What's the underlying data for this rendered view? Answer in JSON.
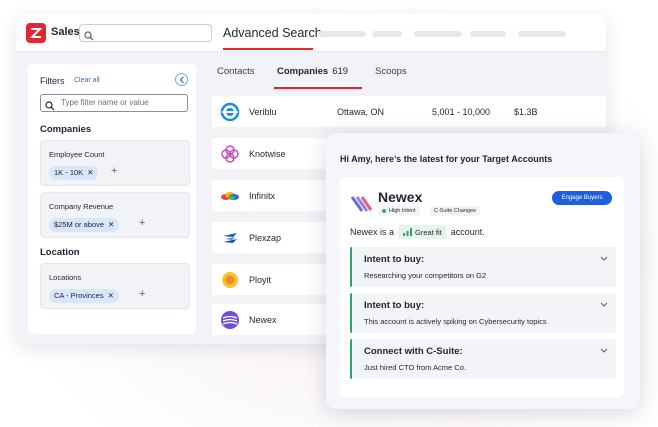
{
  "app": {
    "name": "Sales",
    "page_title": "Advanced Search",
    "search_placeholder": ""
  },
  "filters": {
    "title": "Filters",
    "clear_label": "Clear all",
    "search_placeholder": "Type filter name or value",
    "sections": [
      {
        "title": "Companies",
        "groups": [
          {
            "label": "Employee Count",
            "chip": "1K - 10K"
          },
          {
            "label": "Company Revenue",
            "chip": "$25M or above"
          }
        ]
      },
      {
        "title": "Location",
        "groups": [
          {
            "label": "Locations",
            "chip": "CA - Provinces"
          }
        ]
      }
    ]
  },
  "tabs": [
    {
      "label": "Contacts"
    },
    {
      "label": "Companies",
      "count": "619",
      "active": true
    },
    {
      "label": "Scoops"
    }
  ],
  "companies": [
    {
      "name": "Veriblu",
      "location": "Ottawa, ON",
      "employees": "5,001 - 10,000",
      "revenue": "$1.3B",
      "icon": "veriblu-logo-icon"
    },
    {
      "name": "Knotwise",
      "icon": "knotwise-logo-icon"
    },
    {
      "name": "Infinitx",
      "icon": "infinitx-logo-icon"
    },
    {
      "name": "Plexzap",
      "icon": "plexzap-logo-icon"
    },
    {
      "name": "Ployit",
      "icon": "ployit-logo-icon"
    },
    {
      "name": "Newex",
      "icon": "newex-logo-icon"
    }
  ],
  "insight": {
    "greeting": "Hi Amy, here’s the latest for your Target Accounts",
    "company": "Newex",
    "tags": [
      "High Intent",
      "C-Suite Changes"
    ],
    "engage_label": "Engage Buyers",
    "fit_prefix": "Newex is a",
    "fit_badge": "Great fit",
    "fit_suffix": "account.",
    "signals": [
      {
        "title": "Intent to buy:",
        "detail": "Researching your competitors on G2"
      },
      {
        "title": "Intent to buy:",
        "detail": "This account is actively spiking on Cybersecurity topics"
      },
      {
        "title": "Connect with C-Suite:",
        "detail": "Just hired CTO from Acme Co."
      }
    ]
  },
  "colors": {
    "brand_red": "#e3262d",
    "accent_blue": "#1d5fe0",
    "chip_blue": "#d6e6fb",
    "signal_green": "#2ea36b"
  }
}
